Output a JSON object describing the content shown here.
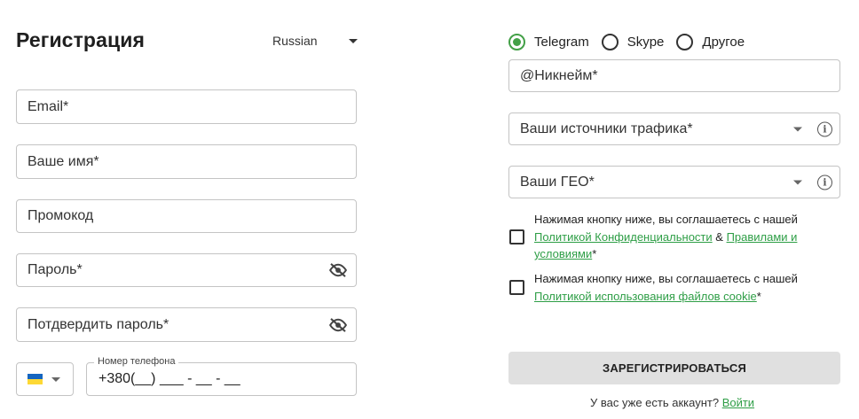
{
  "header": {
    "title": "Регистрация",
    "language": "Russian"
  },
  "form": {
    "email_placeholder": "Email*",
    "name_placeholder": "Ваше имя*",
    "promo_placeholder": "Промокод",
    "password_placeholder": "Пароль*",
    "confirm_password_placeholder": "Потдвердить пароль*",
    "phone": {
      "label": "Номер телефона",
      "value": "+380(__) ___ - __ - __",
      "country_flag": "ukraine-flag-icon"
    }
  },
  "messenger": {
    "options": [
      {
        "label": "Telegram",
        "selected": true
      },
      {
        "label": "Skype",
        "selected": false
      },
      {
        "label": "Другое",
        "selected": false
      }
    ],
    "nickname_placeholder": "@Никнейм*"
  },
  "selects": {
    "traffic_sources": "Ваши источники трафика*",
    "geo": "Ваши ГЕО*"
  },
  "consents": {
    "privacy": {
      "prefix": "Нажимая кнопку ниже, вы соглашаетесь с нашей",
      "privacy_link": "Политикой Конфиденциальности",
      "and": " & ",
      "terms_link_1": "Правилами и",
      "terms_link_2": "условиями",
      "suffix": "*"
    },
    "cookies": {
      "prefix": "Нажимая кнопку ниже, вы соглашаетесь с нашей",
      "cookie_link": "Политикой использования файлов cookie",
      "suffix": "*"
    }
  },
  "actions": {
    "submit_label": "ЗАРЕГИСТРИРОВАТЬСЯ",
    "have_account_text": "У вас уже есть аккаунт? ",
    "login_link": "Войти"
  },
  "colors": {
    "accent": "#43a047",
    "link": "#2e9e46",
    "button_bg": "#e0e0e0",
    "border": "#c4c4c4"
  }
}
